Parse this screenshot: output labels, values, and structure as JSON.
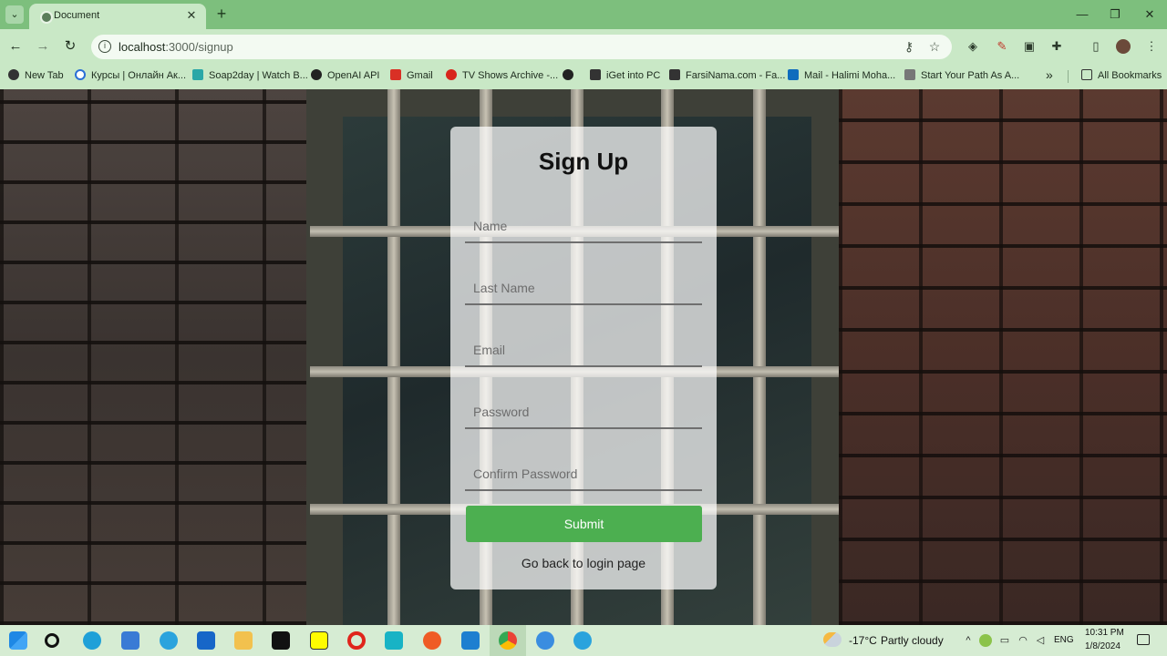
{
  "browser": {
    "tab_title": "Document",
    "tab_close": "✕",
    "new_tab": "+",
    "tab_list": "⌄",
    "window_controls": {
      "minimize": "—",
      "restore": "❐",
      "close": "✕"
    },
    "nav": {
      "back": "←",
      "forward": "→",
      "reload": "↻"
    },
    "url_host": "localhost",
    "url_path": ":3000/signup",
    "omnibox_icons": {
      "info": "i",
      "key": "⚷",
      "star": "☆"
    },
    "extension_icons": [
      "extension-a",
      "extension-pen",
      "extension-doc",
      "puzzle",
      "side-panel",
      "profile",
      "menu"
    ],
    "bookmarks": [
      {
        "label": "New Tab",
        "icon": "globe-icon",
        "color": "#333333"
      },
      {
        "label": "Курсы | Онлайн Ак...",
        "icon": "circle-icon",
        "color": "#2a6fd6"
      },
      {
        "label": "Soap2day | Watch B...",
        "icon": "soap-icon",
        "color": "#2aa7a7"
      },
      {
        "label": "OpenAI API",
        "icon": "openai-icon",
        "color": "#222222"
      },
      {
        "label": "Gmail",
        "icon": "gmail-icon",
        "color": "#d93025"
      },
      {
        "label": "TV Shows Archive -...",
        "icon": "tv-icon",
        "color": "#d8261c"
      },
      {
        "label": "",
        "icon": "globe-icon",
        "color": "#222222"
      },
      {
        "label": "iGet into PC",
        "icon": "igetintopc-icon",
        "color": "#333333"
      },
      {
        "label": "FarsiNama.com - Fa...",
        "icon": "farsinama-icon",
        "color": "#333333"
      },
      {
        "label": "Mail - Halimi Moha...",
        "icon": "outlook-icon",
        "color": "#0f6cbd"
      },
      {
        "label": "Start Your Path As A...",
        "icon": "path-icon",
        "color": "#555555"
      }
    ],
    "bookmarks_overflow": "»",
    "all_bookmarks": "All Bookmarks"
  },
  "form": {
    "title": "Sign Up",
    "fields": {
      "name": "Name",
      "last_name": "Last Name",
      "email": "Email",
      "password": "Password",
      "confirm_password": "Confirm Password"
    },
    "submit_label": "Submit",
    "back_link": "Go back to login page"
  },
  "taskbar": {
    "apps": [
      {
        "name": "windows-start",
        "color": "#1e88e5"
      },
      {
        "name": "search",
        "color": "#111111"
      },
      {
        "name": "edge",
        "color": "#1fa0d8"
      },
      {
        "name": "store",
        "color": "#3a7bd5"
      },
      {
        "name": "telegram",
        "color": "#2aa3dd"
      },
      {
        "name": "mail",
        "color": "#1766c8"
      },
      {
        "name": "file-explorer",
        "color": "#f2c14e"
      },
      {
        "name": "tiktok",
        "color": "#111111"
      },
      {
        "name": "snapchat",
        "color": "#fffc00"
      },
      {
        "name": "opera",
        "color": "#e0241b"
      },
      {
        "name": "webstorm",
        "color": "#18b3c5"
      },
      {
        "name": "postman",
        "color": "#ef5b25"
      },
      {
        "name": "vscode",
        "color": "#1e7fd0"
      },
      {
        "name": "chrome",
        "color": "#4285f4"
      },
      {
        "name": "app-blue",
        "color": "#3a8de0"
      },
      {
        "name": "telegram-2",
        "color": "#2aa3dd"
      }
    ],
    "weather_temp": "-17°C",
    "weather_desc": "Partly cloudy",
    "tray_chevron": "^",
    "language": "ENG",
    "time": "10:31 PM",
    "date": "1/8/2024",
    "notification_icon": "notification-icon"
  },
  "colors": {
    "submit_bg": "#4caf50",
    "browser_frame": "#7dbf7d",
    "browser_toolbar": "#c9e8c6"
  }
}
